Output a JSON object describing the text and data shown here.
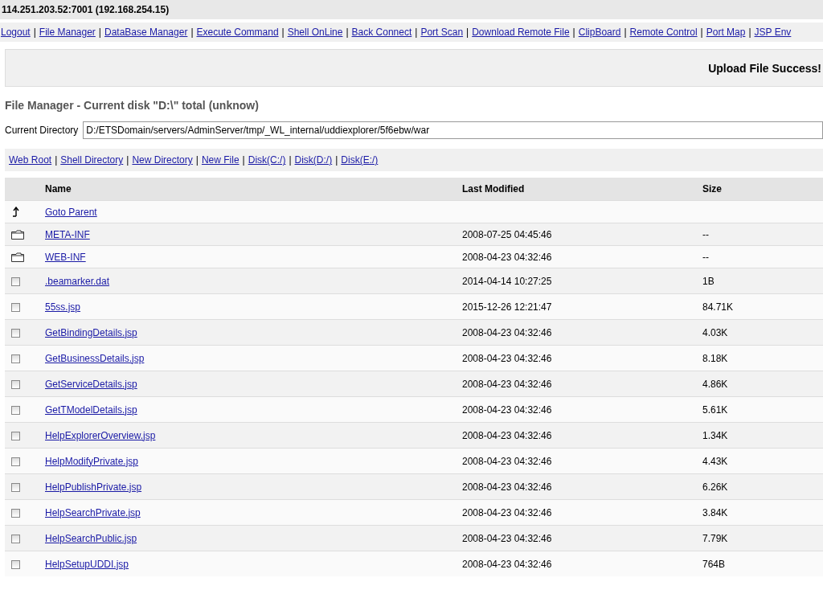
{
  "title": "114.251.203.52:7001 (192.168.254.15)",
  "nav": [
    {
      "kind": "link",
      "text": "Logout"
    },
    {
      "kind": "separator",
      "text": "|"
    },
    {
      "kind": "link",
      "text": "File Manager"
    },
    {
      "kind": "separator",
      "text": "|"
    },
    {
      "kind": "link",
      "text": "DataBase Manager"
    },
    {
      "kind": "separator",
      "text": "|"
    },
    {
      "kind": "link",
      "text": "Execute Command"
    },
    {
      "kind": "separator",
      "text": "|"
    },
    {
      "kind": "link",
      "text": "Shell OnLine"
    },
    {
      "kind": "separator",
      "text": "|"
    },
    {
      "kind": "link",
      "text": "Back Connect"
    },
    {
      "kind": "separator",
      "text": "|"
    },
    {
      "kind": "link",
      "text": "Port Scan"
    },
    {
      "kind": "separator",
      "text": "|"
    },
    {
      "kind": "link",
      "text": "Download Remote File"
    },
    {
      "kind": "separator",
      "text": "|"
    },
    {
      "kind": "link",
      "text": "ClipBoard"
    },
    {
      "kind": "separator",
      "text": "|"
    },
    {
      "kind": "link",
      "text": "Remote Control"
    },
    {
      "kind": "separator",
      "text": "|"
    },
    {
      "kind": "link",
      "text": "Port Map"
    },
    {
      "kind": "separator",
      "text": "|"
    },
    {
      "kind": "link",
      "text": "JSP Env"
    }
  ],
  "message": "Upload File Success!",
  "heading": "File Manager - Current disk \"D:\\\" total (unknow)",
  "directory": {
    "label": "Current Directory",
    "value": "D:/ETSDomain/servers/AdminServer/tmp/_WL_internal/uddiexplorer/5f6ebw/war"
  },
  "toolbar": [
    {
      "kind": "link",
      "text": "Web Root"
    },
    {
      "kind": "separator",
      "text": "|"
    },
    {
      "kind": "link",
      "text": "Shell Directory"
    },
    {
      "kind": "separator",
      "text": "|"
    },
    {
      "kind": "link",
      "text": "New Directory"
    },
    {
      "kind": "separator",
      "text": "|"
    },
    {
      "kind": "link",
      "text": "New File"
    },
    {
      "kind": "separator",
      "text": "|"
    },
    {
      "kind": "link",
      "text": "Disk(C:/)"
    },
    {
      "kind": "separator",
      "text": "|"
    },
    {
      "kind": "link",
      "text": "Disk(D:/)"
    },
    {
      "kind": "separator",
      "text": "|"
    },
    {
      "kind": "link",
      "text": "Disk(E:/)"
    }
  ],
  "table": {
    "columns": [
      "Name",
      "Last Modified",
      "Size"
    ],
    "rows": [
      {
        "kind": "parent",
        "name": "Goto Parent"
      },
      {
        "kind": "folder",
        "name": "META-INF",
        "modified": "2008-07-25 04:45:46",
        "size": "--"
      },
      {
        "kind": "folder",
        "name": "WEB-INF",
        "modified": "2008-04-23 04:32:46",
        "size": "--"
      },
      {
        "kind": "file",
        "checked": false,
        "name": ".beamarker.dat",
        "modified": "2014-04-14 10:27:25",
        "size": "1B"
      },
      {
        "kind": "file",
        "checked": false,
        "name": "55ss.jsp",
        "modified": "2015-12-26 12:21:47",
        "size": "84.71K"
      },
      {
        "kind": "file",
        "checked": false,
        "name": "GetBindingDetails.jsp",
        "modified": "2008-04-23 04:32:46",
        "size": "4.03K"
      },
      {
        "kind": "file",
        "checked": false,
        "name": "GetBusinessDetails.jsp",
        "modified": "2008-04-23 04:32:46",
        "size": "8.18K"
      },
      {
        "kind": "file",
        "checked": false,
        "name": "GetServiceDetails.jsp",
        "modified": "2008-04-23 04:32:46",
        "size": "4.86K"
      },
      {
        "kind": "file",
        "checked": false,
        "name": "GetTModelDetails.jsp",
        "modified": "2008-04-23 04:32:46",
        "size": "5.61K"
      },
      {
        "kind": "file",
        "checked": false,
        "name": "HelpExplorerOverview.jsp",
        "modified": "2008-04-23 04:32:46",
        "size": "1.34K"
      },
      {
        "kind": "file",
        "checked": false,
        "name": "HelpModifyPrivate.jsp",
        "modified": "2008-04-23 04:32:46",
        "size": "4.43K"
      },
      {
        "kind": "file",
        "checked": false,
        "name": "HelpPublishPrivate.jsp",
        "modified": "2008-04-23 04:32:46",
        "size": "6.26K"
      },
      {
        "kind": "file",
        "checked": false,
        "name": "HelpSearchPrivate.jsp",
        "modified": "2008-04-23 04:32:46",
        "size": "3.84K"
      },
      {
        "kind": "file",
        "checked": false,
        "name": "HelpSearchPublic.jsp",
        "modified": "2008-04-23 04:32:46",
        "size": "7.79K"
      },
      {
        "kind": "file",
        "checked": false,
        "name": "HelpSetupUDDI.jsp",
        "modified": "2008-04-23 04:32:46",
        "size": "764B"
      }
    ]
  }
}
